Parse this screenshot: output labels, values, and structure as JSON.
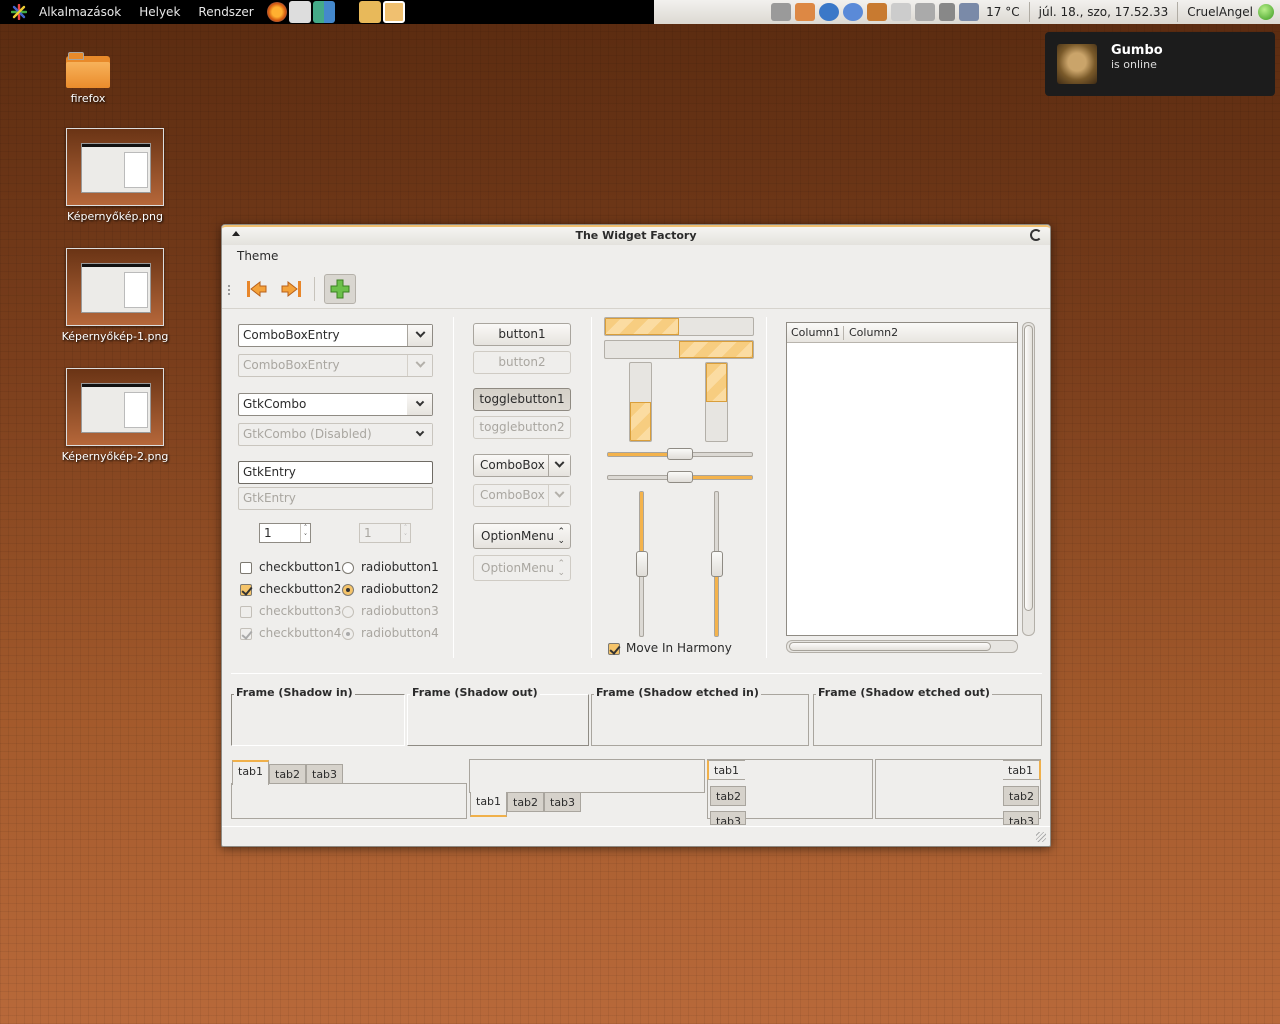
{
  "top_panel": {
    "menu": [
      "Alkalmazások",
      "Helyek",
      "Rendszer"
    ],
    "weather": "17 °C",
    "datetime": "júl. 18., szo, 17.52.33",
    "user": "CruelAngel"
  },
  "notification": {
    "name": "Gumbo",
    "status": "is online"
  },
  "desktop_icons": [
    "firefox",
    "Képernyőkép.png",
    "Képernyőkép-1.png",
    "Képernyőkép-2.png"
  ],
  "window": {
    "title": "The Widget Factory",
    "menu_theme": "Theme",
    "combo_entry": "ComboBoxEntry",
    "combo_entry_disabled": "ComboBoxEntry",
    "gtk_combo": "GtkCombo",
    "gtk_combo_disabled": "GtkCombo (Disabled)",
    "entry": "GtkEntry",
    "entry_disabled_placeholder": "GtkEntry",
    "spin1": "1",
    "spin2": "1",
    "checks": [
      {
        "label": "checkbutton1",
        "checked": false,
        "disabled": false
      },
      {
        "label": "checkbutton2",
        "checked": true,
        "disabled": false
      },
      {
        "label": "checkbutton3",
        "checked": false,
        "disabled": true
      },
      {
        "label": "checkbutton4",
        "checked": true,
        "disabled": true
      }
    ],
    "radios": [
      {
        "label": "radiobutton1",
        "checked": false,
        "disabled": false
      },
      {
        "label": "radiobutton2",
        "checked": true,
        "disabled": false
      },
      {
        "label": "radiobutton3",
        "checked": false,
        "disabled": true
      },
      {
        "label": "radiobutton4",
        "checked": true,
        "disabled": true
      }
    ],
    "button1": "button1",
    "button2": "button2",
    "toggle1": "togglebutton1",
    "toggle2": "togglebutton2",
    "combobox": "ComboBox",
    "combobox_disabled": "ComboBox",
    "optionmenu": "OptionMenu",
    "optionmenu_disabled": "OptionMenu",
    "progress": {
      "h1": 0.5,
      "h2": 0.5,
      "v1": 0.5,
      "v2": 0.5
    },
    "scales": {
      "h1": 0.5,
      "h2": 0.5,
      "v1": 0.5,
      "v2": 0.5
    },
    "move_in_harmony": "Move In Harmony",
    "treeview_columns": [
      "Column1",
      "Column2"
    ],
    "frames": [
      "Frame (Shadow in)",
      "Frame (Shadow out)",
      "Frame (Shadow etched in)",
      "Frame (Shadow etched out)"
    ],
    "tabs": [
      "tab1",
      "tab2",
      "tab3"
    ]
  },
  "colors": {
    "accent": "#f0b04a",
    "window_bg": "#efeeec",
    "panel_bg": "#000000"
  }
}
